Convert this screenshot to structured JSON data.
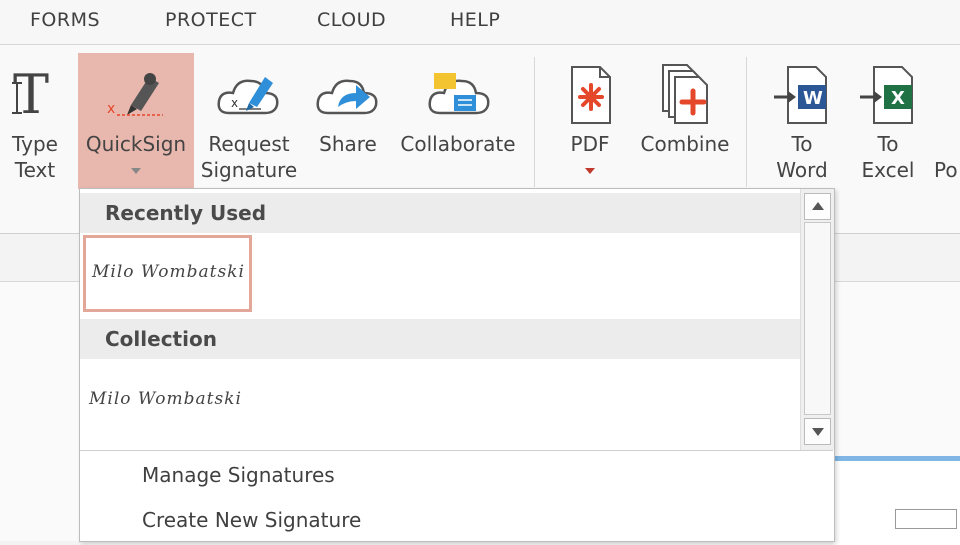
{
  "menu": [
    "FORMS",
    "PROTECT",
    "CLOUD",
    "HELP"
  ],
  "ribbon": {
    "type_text": [
      "Type",
      "Text"
    ],
    "quicksign": "QuickSign",
    "request_signature": [
      "Request",
      "Signature"
    ],
    "share": "Share",
    "collaborate": "Collaborate",
    "pdf": "PDF",
    "combine": "Combine",
    "to_word": [
      "To",
      "Word"
    ],
    "to_excel": [
      "To",
      "Excel"
    ],
    "partial": "Po"
  },
  "dropdown": {
    "recently_used": "Recently Used",
    "collection": "Collection",
    "signature_recent": "Milo Wombatski",
    "signature_collection": "Milo Wombatski",
    "manage": "Manage Signatures",
    "create": "Create New Signature"
  },
  "colors": {
    "active_button": "#e8b7ad",
    "selected_border": "#e3a79a",
    "accent_red": "#e5472b",
    "word_blue": "#2b5797",
    "excel_green": "#207245"
  }
}
